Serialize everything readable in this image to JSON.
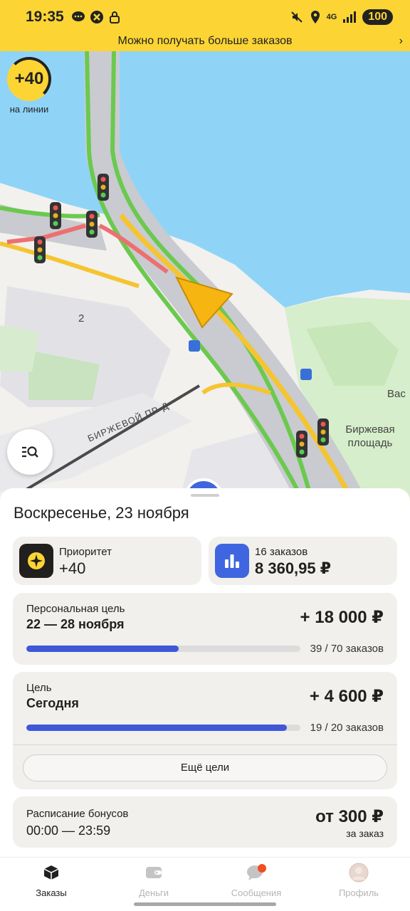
{
  "status_bar": {
    "time": "19:35",
    "network": "4G",
    "battery": "100",
    "left_icons": [
      "message-icon",
      "app-icon",
      "lock-icon"
    ],
    "right_icons": [
      "mute-icon",
      "location-icon",
      "signal-icon"
    ]
  },
  "promo_banner": {
    "text": "Можно получать больше заказов"
  },
  "map": {
    "priority_badge": "+40",
    "online_label": "на линии",
    "labels": {
      "block_number": "2",
      "street": "БИРЖЕВОЙ ПР-Д",
      "square": "Биржевая площадь",
      "cut_label": "Вас"
    }
  },
  "sheet": {
    "date": "Воскресенье, 23 ноября",
    "priority_card": {
      "label": "Приоритет",
      "value": "+40"
    },
    "earnings_card": {
      "label": "16 заказов",
      "value": "8 360,95 ₽"
    },
    "personal_goal": {
      "title": "Персональная цель",
      "period": "22 — 28 ноября",
      "amount": "+ 18 000 ₽",
      "progress_text": "39 / 70 заказов",
      "progress_fraction": 0.557
    },
    "daily_goal": {
      "title": "Цель",
      "period": "Сегодня",
      "amount": "+ 4 600 ₽",
      "progress_text": "19 / 20 заказов",
      "progress_fraction": 0.95
    },
    "more_goals_label": "Ещё цели",
    "bonus_schedule": {
      "title": "Расписание бонусов",
      "time": "00:00 — 23:59",
      "amount": "от 300 ₽",
      "per": "за заказ"
    }
  },
  "nav": {
    "items": [
      {
        "label": "Заказы",
        "icon": "orders-icon",
        "active": true
      },
      {
        "label": "Деньги",
        "icon": "wallet-icon",
        "active": false
      },
      {
        "label": "Сообщения",
        "icon": "messages-icon",
        "active": false
      },
      {
        "label": "Профиль",
        "icon": "profile-icon",
        "active": false
      }
    ]
  },
  "colors": {
    "brand_yellow": "#fcd534",
    "accent_blue": "#3f57d8",
    "notification_red": "#f04e23"
  }
}
